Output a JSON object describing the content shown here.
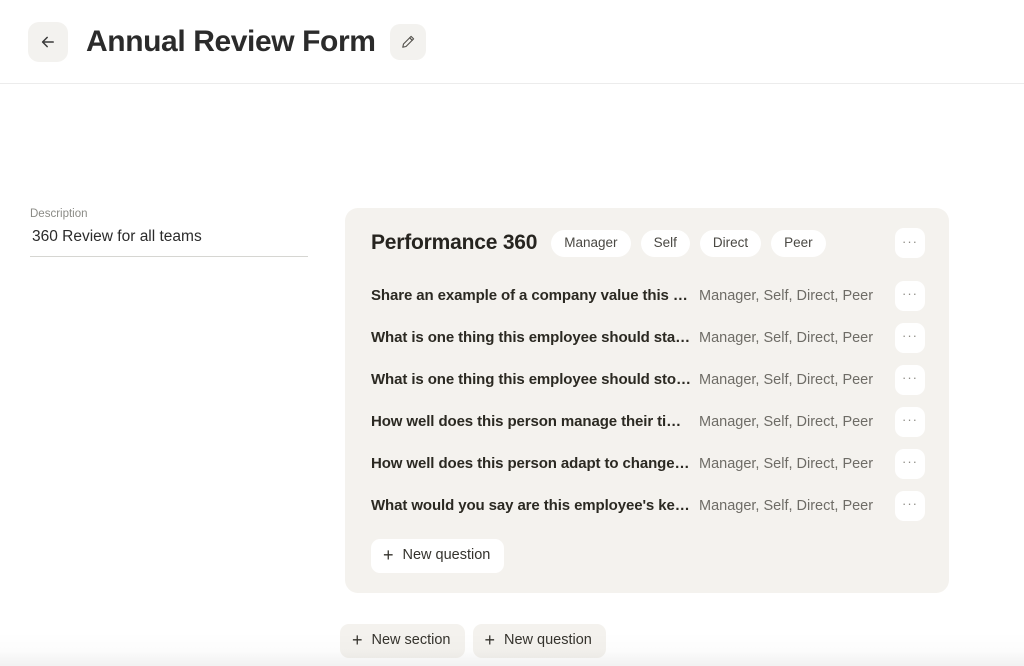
{
  "header": {
    "back_icon": "arrow-left-icon",
    "title": "Annual Review Form",
    "edit_icon": "pencil-icon"
  },
  "description": {
    "label": "Description",
    "value": "360 Review for all teams",
    "placeholder": "Description"
  },
  "section": {
    "title": "Performance 360",
    "audience_chips": [
      "Manager",
      "Self",
      "Direct",
      "Peer"
    ],
    "menu_label": "···",
    "questions": [
      {
        "text": "Share an example of a company value this pe…",
        "audience": "Manager, Self, Direct, Peer",
        "menu_label": "···"
      },
      {
        "text": "What is one thing this employee should start …",
        "audience": "Manager, Self, Direct, Peer",
        "menu_label": "···"
      },
      {
        "text": "What is one thing this employee should stop …",
        "audience": "Manager, Self, Direct, Peer",
        "menu_label": "···"
      },
      {
        "text": "How well does this person manage their time …",
        "audience": "Manager, Self, Direct, Peer",
        "menu_label": "···"
      },
      {
        "text": "How well does this person adapt to change? …",
        "audience": "Manager, Self, Direct, Peer",
        "menu_label": "···"
      },
      {
        "text": "What would you say are this employee's key s…",
        "audience": "Manager, Self, Direct, Peer",
        "menu_label": "···"
      }
    ],
    "new_question_label": "New question",
    "plus_glyph": "+"
  },
  "footer": {
    "new_section_label": "New section",
    "new_question_label": "New question",
    "plus_glyph": "+"
  },
  "colors": {
    "page_background": "#ffffff",
    "card_background": "#f4f2ee",
    "chip_background": "#ffffff",
    "text_primary": "#2b2b2b",
    "text_secondary": "#6e6c66",
    "divider": "#ececec"
  }
}
